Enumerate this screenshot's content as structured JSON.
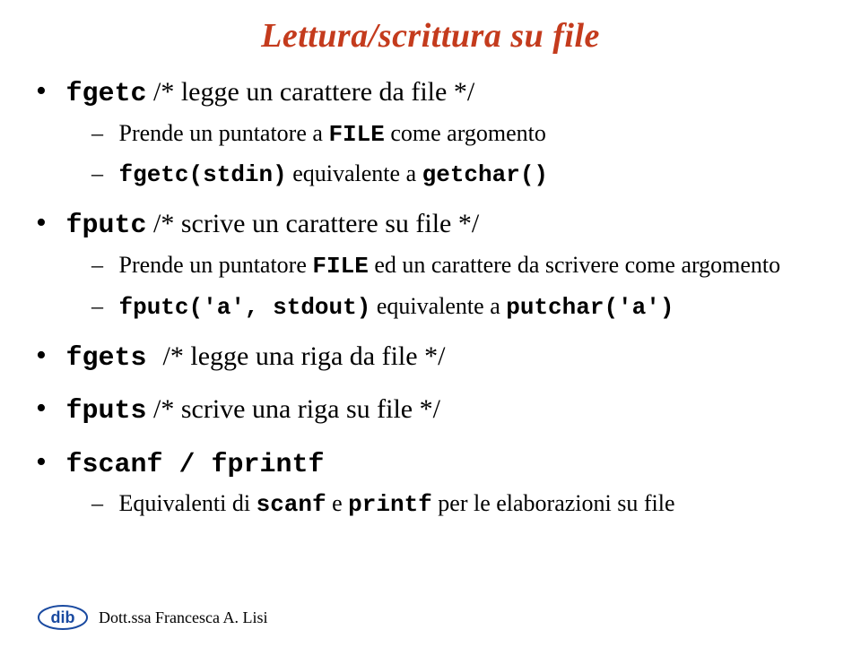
{
  "title": "Lettura/scrittura su file",
  "bullets": [
    {
      "line": {
        "before": "",
        "code1": "fgetc",
        "mid": " /* legge un carattere da file */",
        "code2": "",
        "after": ""
      },
      "subs": [
        {
          "before": "Prende un puntatore a ",
          "code1": "FILE",
          "mid": " come argomento",
          "code2": "",
          "after": ""
        },
        {
          "before": "",
          "code1": "fgetc(stdin)",
          "mid": " equivalente a ",
          "code2": "getchar()",
          "after": ""
        }
      ]
    },
    {
      "line": {
        "before": "",
        "code1": "fputc",
        "mid": " /* scrive un carattere su file */",
        "code2": "",
        "after": ""
      },
      "subs": [
        {
          "before": "Prende un puntatore ",
          "code1": "FILE",
          "mid": " ed un carattere da scrivere come argomento",
          "code2": "",
          "after": ""
        },
        {
          "before": "",
          "code1": "fputc('a', stdout)",
          "mid": " equivalente a ",
          "code2": "putchar('a')",
          "after": ""
        }
      ]
    },
    {
      "line": {
        "before": "",
        "code1": "fgets ",
        "mid": " /* legge una riga da file */",
        "code2": "",
        "after": ""
      },
      "subs": []
    },
    {
      "line": {
        "before": "",
        "code1": "fputs",
        "mid": " /* scrive una riga su file */",
        "code2": "",
        "after": ""
      },
      "subs": []
    },
    {
      "line": {
        "before": "",
        "code1": "fscanf / fprintf",
        "mid": "",
        "code2": "",
        "after": ""
      },
      "subs": [
        {
          "before": "Equivalenti di ",
          "code1": "scanf",
          "mid": " e ",
          "code2": "printf",
          "after": " per le elaborazioni su file"
        }
      ]
    }
  ],
  "footer": {
    "logo_text": "dib",
    "author": "Dott.ssa Francesca A. Lisi"
  }
}
